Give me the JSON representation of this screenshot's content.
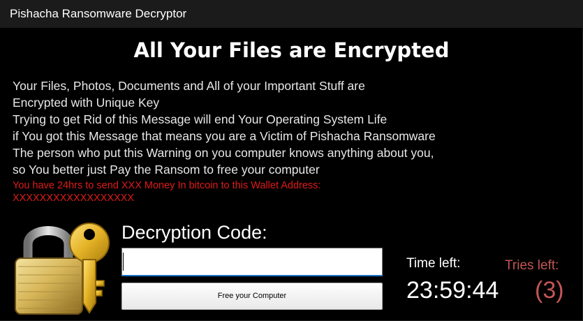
{
  "window": {
    "title": "Pishacha Ransomware Decryptor"
  },
  "main": {
    "headline": "All Your Files are Encrypted",
    "message_lines": [
      "Your Files, Photos, Documents and All of your Important Stuff are",
      "Encrypted with Unique Key",
      "Trying to get Rid of this Message will end Your Operating System Life",
      "if You got this Message that means you are a Victim of Pishacha Ransomware",
      "The person who put this Warning on you computer knows anything about you,",
      "so You better just Pay the Ransom to free your computer"
    ],
    "warning_lines": [
      "You have 24hrs to send XXX Money In bitcoin to this Wallet Address:",
      "XXXXXXXXXXXXXXXXXX"
    ],
    "lock_icon": "padlock-with-key-icon"
  },
  "decryption": {
    "label": "Decryption Code:",
    "input_value": "",
    "button_label": "Free your Computer"
  },
  "timer": {
    "label": "Time left:",
    "value": "23:59:44"
  },
  "tries": {
    "label": "Tries left:",
    "value": "(3)"
  },
  "colors": {
    "background": "#000000",
    "titlebar": "#1b1b1b",
    "text": "#ffffff",
    "warning": "#e01a1a",
    "tries": "#c45555"
  }
}
